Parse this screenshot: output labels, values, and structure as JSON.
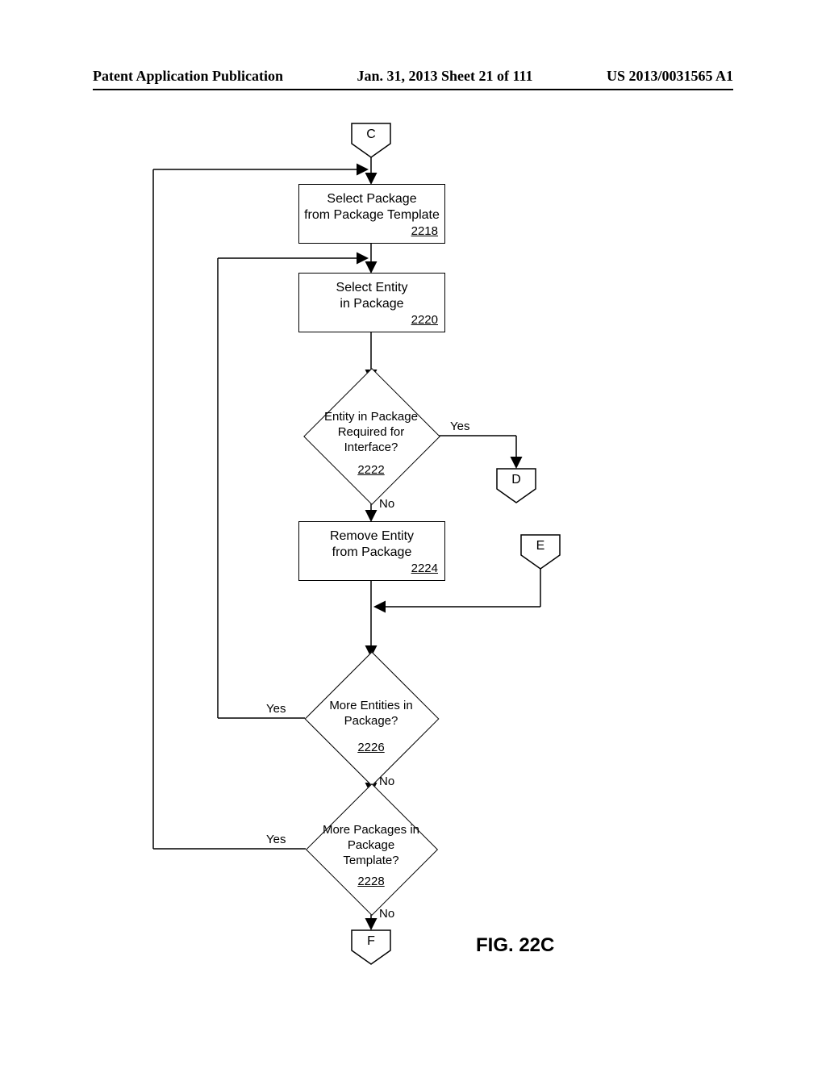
{
  "header": {
    "left": "Patent Application Publication",
    "center": "Jan. 31, 2013  Sheet 21 of 111",
    "right": "US 2013/0031565 A1"
  },
  "figure_label": "FIG. 22C",
  "connectors": {
    "C": "C",
    "D": "D",
    "E": "E",
    "F": "F"
  },
  "steps": {
    "select_package": {
      "text_l1": "Select Package",
      "text_l2": "from Package Template",
      "ref": "2218"
    },
    "select_entity": {
      "text_l1": "Select Entity",
      "text_l2": "in Package",
      "ref": "2220"
    },
    "entity_required": {
      "text_l1": "Entity in Package",
      "text_l2": "Required for",
      "text_l3": "Interface?",
      "ref": "2222"
    },
    "remove_entity": {
      "text_l1": "Remove Entity",
      "text_l2": "from Package",
      "ref": "2224"
    },
    "more_entities": {
      "text_l1": "More Entities in",
      "text_l2": "Package?",
      "ref": "2226"
    },
    "more_packages": {
      "text_l1": "More Packages in",
      "text_l2": "Package",
      "text_l3": "Template?",
      "ref": "2228"
    }
  },
  "labels": {
    "yes": "Yes",
    "no": "No"
  },
  "chart_data": {
    "type": "flowchart",
    "nodes": [
      {
        "id": "C",
        "kind": "offpage",
        "label": "C"
      },
      {
        "id": "2218",
        "kind": "process",
        "label": "Select Package from Package Template"
      },
      {
        "id": "2220",
        "kind": "process",
        "label": "Select Entity in Package"
      },
      {
        "id": "2222",
        "kind": "decision",
        "label": "Entity in Package Required for Interface?"
      },
      {
        "id": "D",
        "kind": "offpage",
        "label": "D"
      },
      {
        "id": "2224",
        "kind": "process",
        "label": "Remove Entity from Package"
      },
      {
        "id": "E",
        "kind": "offpage",
        "label": "E"
      },
      {
        "id": "2226",
        "kind": "decision",
        "label": "More Entities in Package?"
      },
      {
        "id": "2228",
        "kind": "decision",
        "label": "More Packages in Package Template?"
      },
      {
        "id": "F",
        "kind": "offpage",
        "label": "F"
      }
    ],
    "edges": [
      {
        "from": "C",
        "to": "2218",
        "label": ""
      },
      {
        "from": "2218",
        "to": "2220",
        "label": ""
      },
      {
        "from": "2220",
        "to": "2222",
        "label": ""
      },
      {
        "from": "2222",
        "to": "D",
        "label": "Yes"
      },
      {
        "from": "2222",
        "to": "2224",
        "label": "No"
      },
      {
        "from": "2224",
        "to": "2226_merge",
        "label": ""
      },
      {
        "from": "E",
        "to": "2226_merge",
        "label": ""
      },
      {
        "from": "2226_merge",
        "to": "2226",
        "label": ""
      },
      {
        "from": "2226",
        "to": "2220",
        "label": "Yes"
      },
      {
        "from": "2226",
        "to": "2228",
        "label": "No"
      },
      {
        "from": "2228",
        "to": "2218",
        "label": "Yes"
      },
      {
        "from": "2228",
        "to": "F",
        "label": "No"
      }
    ]
  }
}
